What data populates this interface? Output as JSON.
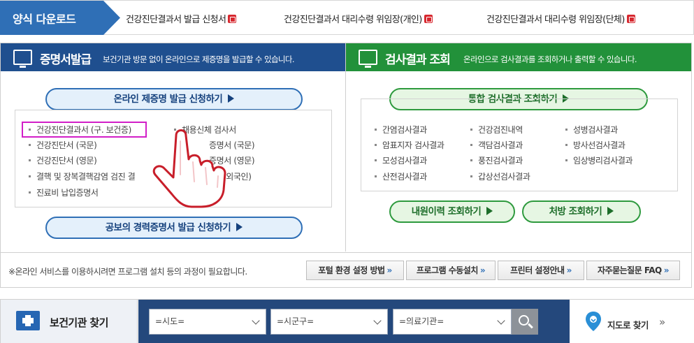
{
  "forms": {
    "title": "양식 다운로드",
    "links": [
      "건강진단결과서 발급 신청서",
      "건강진단결과서 대리수령 위임장(개인)",
      "건강진단결과서 대리수령 위임장(단체)"
    ],
    "file_icon": "pdf-icon"
  },
  "certificate": {
    "title": "증명서발급",
    "subtitle": "보건기관 방문 없이 온라인으로 제증명을 발급할 수 있습니다.",
    "apply_button": "온라인 제증명 발급 신청하기",
    "items_col1": [
      "건강진단결과서 (구. 보건증)",
      "건강진단서 (국문)",
      "건강진단서 (영문)",
      "결핵 및 장복결핵감염 검진 결",
      "진료비 납입증명서"
    ],
    "items_col2": [
      "채용신체 검사서",
      "증명서 (국문)",
      "증명서 (영문)",
      "(외국인)"
    ],
    "career_button": "공보의 경력증명서 발급 신청하기",
    "header_color": "#1f4f8f",
    "highlight_color": "#d21fc8"
  },
  "results": {
    "title": "검사결과 조회",
    "subtitle": "온라인으로 검사결과를 조회하거나 출력할 수 있습니다.",
    "integrated_button": "통합 검사결과 조회하기",
    "items_col1": [
      "간염검사결과",
      "암표지자 검사결과",
      "모성검사결과",
      "산전검사결과"
    ],
    "items_col2": [
      "건강검진내역",
      "객담검사결과",
      "풍진검사결과",
      "갑상선검사결과"
    ],
    "items_col3": [
      "성병검사결과",
      "방사선검사결과",
      "임상병리검사결과"
    ],
    "visit_button": "내원이력 조회하기",
    "prescription_button": "처방 조회하기",
    "header_color": "#22913a"
  },
  "notice": {
    "text": "※온라인 서비스를 이용하시려면 프로그램 설치 등의 과정이 필요합니다.",
    "buttons": [
      "포털 환경 설정 방법",
      "프로그램 수동설치",
      "프린터 설정안내",
      "자주묻는질문 FAQ"
    ],
    "chevron": "»"
  },
  "finder": {
    "title": "보건기관 찾기",
    "select_province": "=시도=",
    "select_city": "=시군구=",
    "select_institution": "=의료기관=",
    "search_icon": "search-icon",
    "map_label": "지도로 찾기",
    "map_arrow": "»",
    "bar_color": "#24487c"
  },
  "pointer_icon": "hand-pointer-icon"
}
